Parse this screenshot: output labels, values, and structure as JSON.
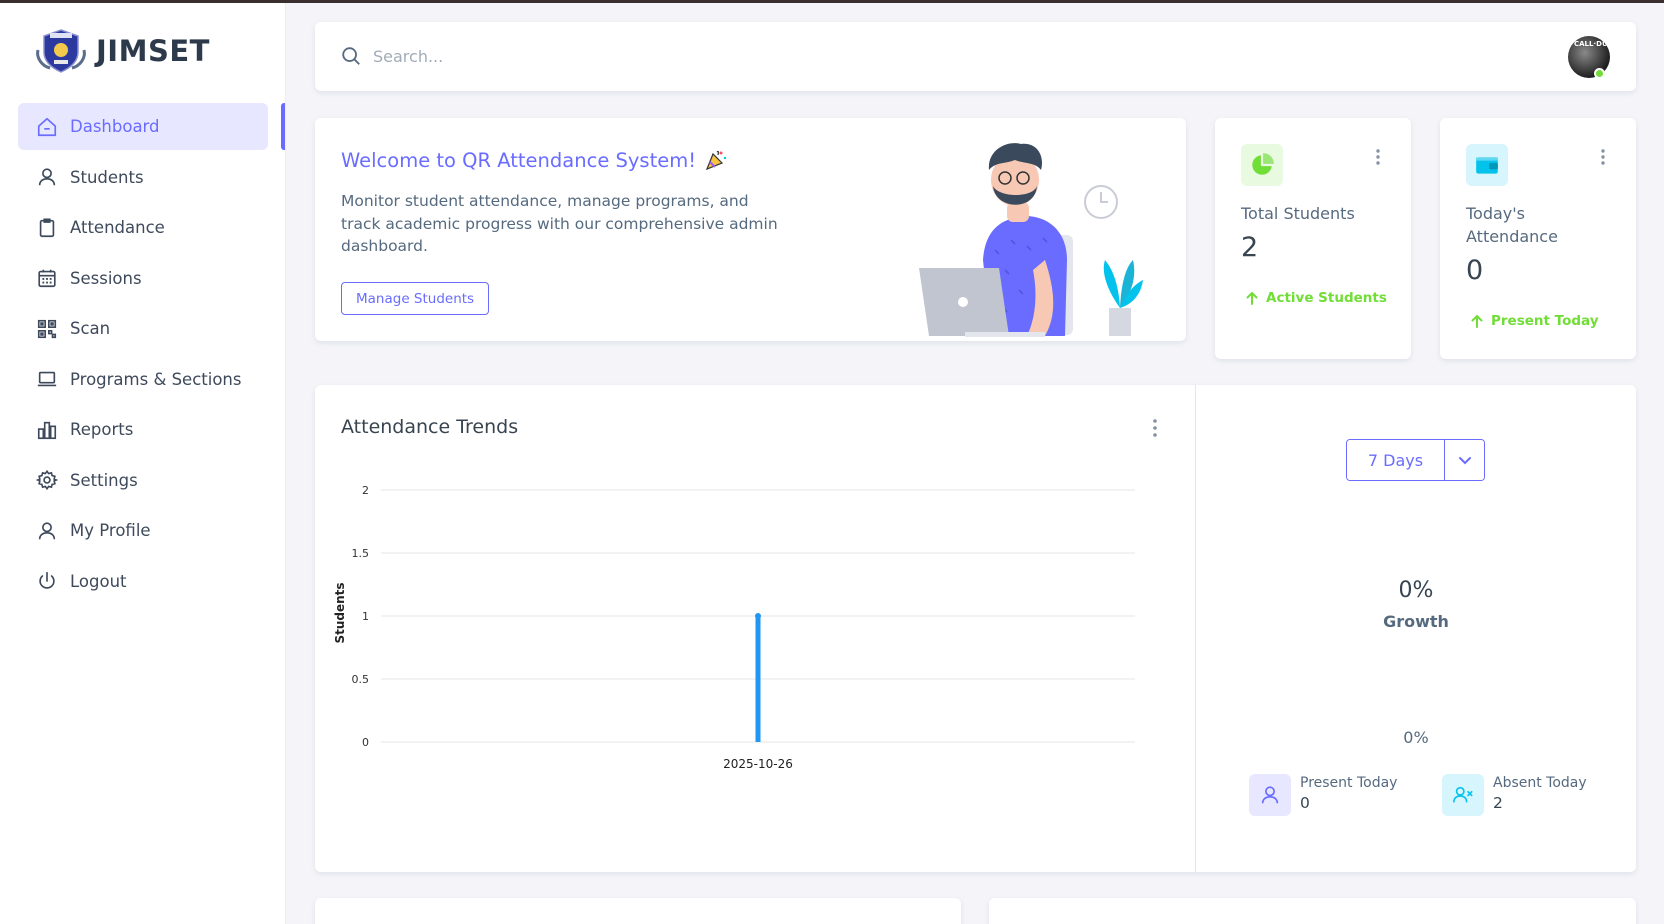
{
  "brand": {
    "name": "JIMSET"
  },
  "sidebar": {
    "items": [
      {
        "label": "Dashboard",
        "icon": "home-icon",
        "active": true
      },
      {
        "label": "Students",
        "icon": "user-icon"
      },
      {
        "label": "Attendance",
        "icon": "clipboard-icon"
      },
      {
        "label": "Sessions",
        "icon": "calendar-icon"
      },
      {
        "label": "Scan",
        "icon": "qr-code-icon"
      },
      {
        "label": "Programs & Sections",
        "icon": "laptop-icon"
      },
      {
        "label": "Reports",
        "icon": "bar-chart-icon"
      },
      {
        "label": "Settings",
        "icon": "gear-icon"
      },
      {
        "label": "My Profile",
        "icon": "user-icon"
      },
      {
        "label": "Logout",
        "icon": "power-icon"
      }
    ]
  },
  "search": {
    "placeholder": "Search..."
  },
  "avatar": {
    "text": "CALL·DUTY",
    "status_color": "#71dd37"
  },
  "welcome": {
    "title": "Welcome to QR Attendance System!",
    "description": "Monitor student attendance, manage programs, and track academic progress with our comprehensive admin dashboard.",
    "button_label": "Manage Students"
  },
  "stats": [
    {
      "label": "Total Students",
      "value": "2",
      "trend": "Active Students",
      "icon": "pie-chart-icon",
      "icon_bg": "#e8fadf",
      "icon_color": "#71dd37"
    },
    {
      "label": "Today's Attendance",
      "value": "0",
      "trend": "Present Today",
      "icon": "wallet-icon",
      "icon_bg": "#d7f5fc",
      "icon_color": "#03c3ec"
    }
  ],
  "trends": {
    "title": "Attendance Trends",
    "range_label": "7 Days",
    "growth_value": "0%",
    "growth_label": "Growth",
    "gauge_value": "0%",
    "present": {
      "label": "Present Today",
      "value": "0"
    },
    "absent": {
      "label": "Absent Today",
      "value": "2"
    }
  },
  "chart_data": {
    "type": "bar",
    "categories": [
      "2025-10-26"
    ],
    "series": [
      {
        "values": [
          1
        ],
        "color": "#2196f3"
      }
    ],
    "ylabel": "Students",
    "xlabel": "",
    "ylim": [
      0,
      2
    ],
    "yticks": [
      "0",
      "0.5",
      "1",
      "1.5",
      "2"
    ],
    "grid": true
  },
  "colors": {
    "primary": "#696cff",
    "success": "#71dd37",
    "info": "#03c3ec"
  }
}
